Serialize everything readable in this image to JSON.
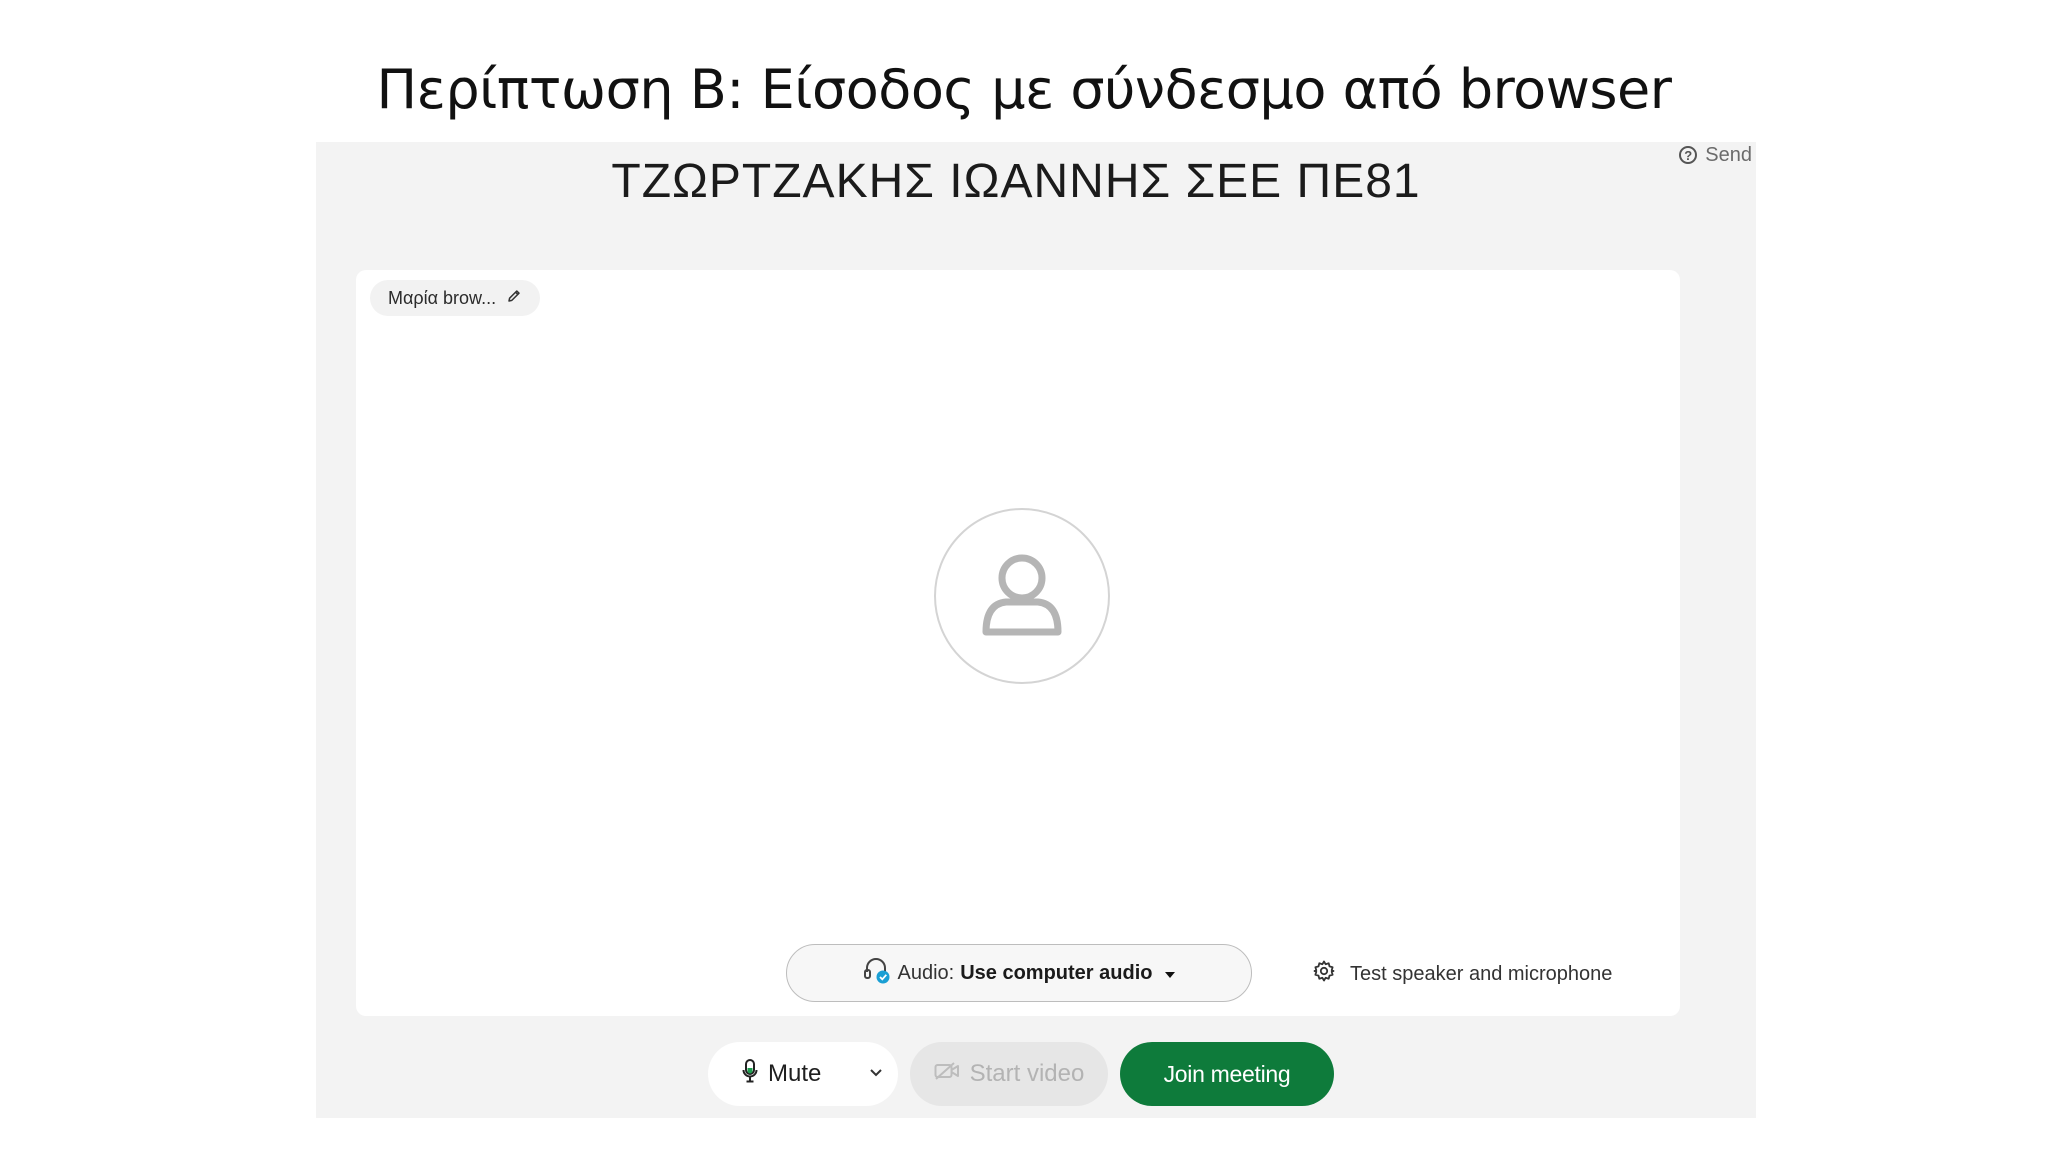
{
  "slide": {
    "title": "Περίπτωση Β: Είσοδος με σύνδεσμο από browser"
  },
  "header": {
    "help_label": "Send",
    "meeting_title": "ΤΖΩΡΤΖΑΚΗΣ ΙΩΑΝΝΗΣ ΣΕΕ ΠΕ81"
  },
  "preview": {
    "display_name": "Μαρία brow..."
  },
  "audio": {
    "prefix": "Audio:",
    "selected": "Use computer audio",
    "test_label": "Test speaker and microphone"
  },
  "controls": {
    "mute_label": "Mute",
    "video_label": "Start video",
    "join_label": "Join meeting"
  },
  "colors": {
    "join_button": "#0e7b3b",
    "audio_check_badge": "#1a9fd4",
    "window_bg": "#f3f3f3"
  },
  "icons": {
    "help": "question-circle-icon",
    "edit": "pencil-icon",
    "avatar": "user-icon",
    "audio": "headset-check-icon",
    "dropdown": "caret-down-icon",
    "settings": "gear-icon",
    "mic": "microphone-icon",
    "mute_options": "chevron-down-icon",
    "video": "video-camera-icon"
  }
}
